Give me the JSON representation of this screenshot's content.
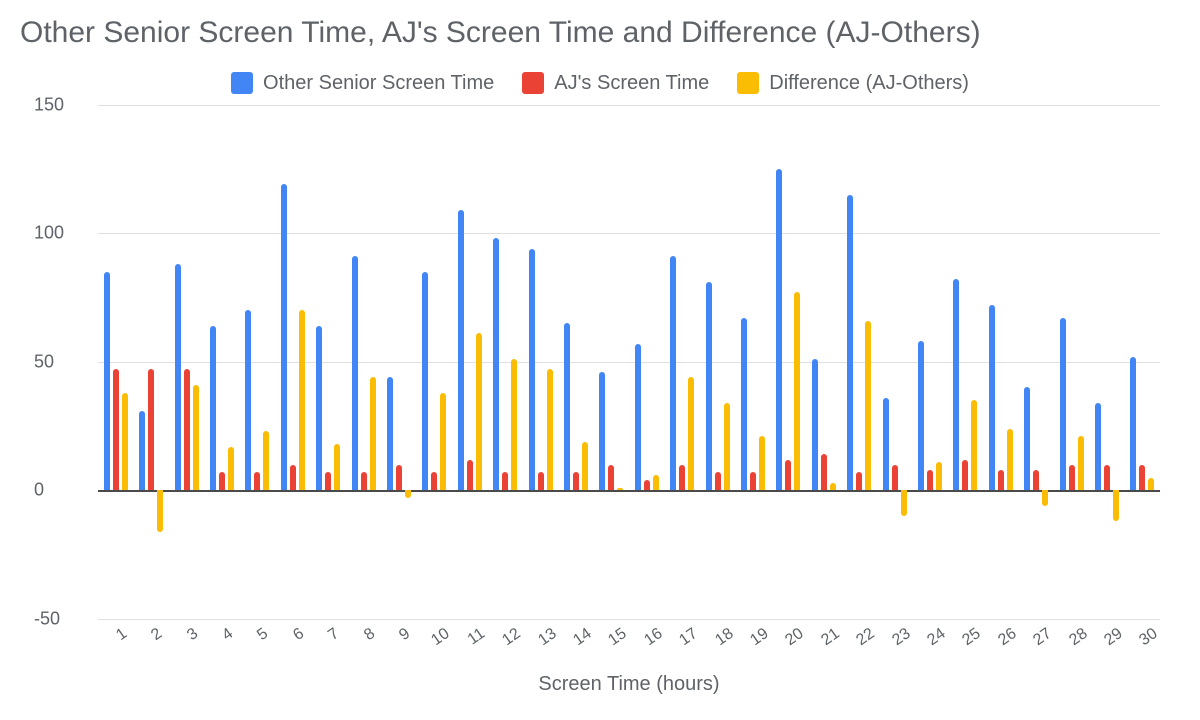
{
  "title": "Other Senior Screen Time, AJ's Screen Time and Difference (AJ-Others)",
  "legend": {
    "items": [
      {
        "name": "Other Senior Screen Time",
        "color": "#4285f4"
      },
      {
        "name": "AJ's Screen Time",
        "color": "#ea4335"
      },
      {
        "name": "Difference (AJ-Others)",
        "color": "#fbbc04"
      }
    ]
  },
  "yaxis": {
    "ticks": [
      150,
      100,
      50,
      0,
      -50
    ],
    "min": -50,
    "max": 150
  },
  "xaxis": {
    "title": "Screen Time (hours)"
  },
  "chart_data": {
    "type": "bar",
    "title": "Other Senior Screen Time, AJ's Screen Time and Difference (AJ-Others)",
    "xlabel": "Screen Time (hours)",
    "ylabel": "",
    "ylim": [
      -50,
      150
    ],
    "categories": [
      "1",
      "2",
      "3",
      "4",
      "5",
      "6",
      "7",
      "8",
      "9",
      "10",
      "11",
      "12",
      "13",
      "14",
      "15",
      "16",
      "17",
      "18",
      "19",
      "20",
      "21",
      "22",
      "23",
      "24",
      "25",
      "26",
      "27",
      "28",
      "29",
      "30"
    ],
    "series": [
      {
        "name": "Other Senior Screen Time",
        "color": "#4285f4",
        "values": [
          85,
          31,
          88,
          64,
          70,
          119,
          64,
          91,
          44,
          85,
          109,
          98,
          94,
          65,
          46,
          57,
          91,
          81,
          67,
          125,
          51,
          115,
          36,
          58,
          82,
          72,
          40,
          67,
          34,
          52
        ]
      },
      {
        "name": "AJ's Screen Time",
        "color": "#ea4335",
        "values": [
          47,
          47,
          47,
          7,
          7,
          10,
          7,
          7,
          10,
          7,
          12,
          7,
          7,
          7,
          10,
          4,
          10,
          7,
          7,
          12,
          14,
          7,
          10,
          8,
          12,
          8,
          8,
          10,
          10,
          10
        ]
      },
      {
        "name": "Difference (AJ-Others)",
        "color": "#fbbc04",
        "values": [
          38,
          -16,
          41,
          17,
          23,
          70,
          18,
          44,
          -3,
          38,
          61,
          51,
          47,
          19,
          1,
          6,
          44,
          34,
          21,
          77,
          3,
          66,
          -10,
          11,
          35,
          24,
          -6,
          21,
          -12,
          5
        ]
      }
    ]
  }
}
